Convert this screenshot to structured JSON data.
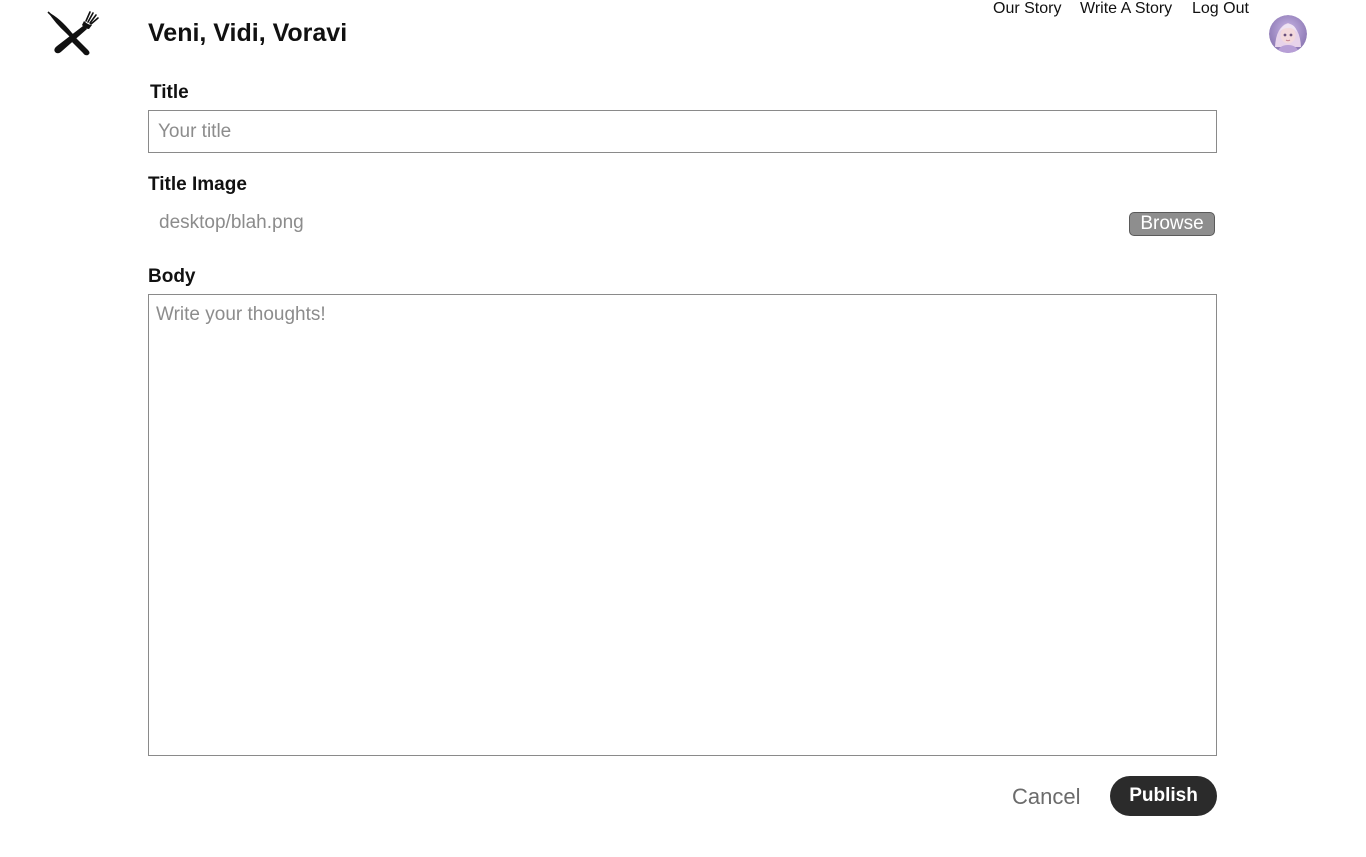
{
  "header": {
    "logo_icon": "crossed-knife-fork-icon",
    "site_title": "Veni, Vidi, Voravi",
    "nav": {
      "our_story": "Our Story",
      "write_story": "Write A Story",
      "log_out": "Log Out"
    },
    "avatar_icon": "user-avatar"
  },
  "form": {
    "title": {
      "label": "Title",
      "value": "",
      "placeholder": "Your title"
    },
    "title_image": {
      "label": "Title Image",
      "file_name": "desktop/blah.png",
      "browse_label": "Browse"
    },
    "body": {
      "label": "Body",
      "value": "",
      "placeholder": "Write your thoughts!"
    },
    "actions": {
      "cancel_label": "Cancel",
      "publish_label": "Publish"
    }
  },
  "colors": {
    "primary_button": "#2b2b2b",
    "browse_button": "#8e8e8e",
    "placeholder_text": "#8c8c8c",
    "border": "#8a8a8a"
  }
}
